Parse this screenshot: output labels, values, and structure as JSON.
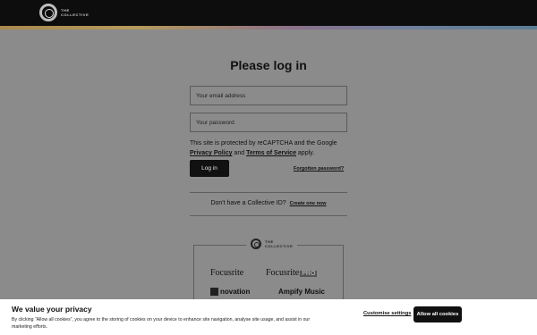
{
  "header": {
    "logo_text_1": "THE",
    "logo_text_2": "COLLECTIVE"
  },
  "login": {
    "title": "Please log in",
    "email_placeholder": "Your email address",
    "password_placeholder": "Your password",
    "note_1": "This site is protected by reCAPTCHA and the Google ",
    "privacy_link": "Privacy Policy",
    "note_and": " and ",
    "terms_link": "Terms of Service",
    "note_end": " apply.",
    "login_button": "Log in",
    "forgot_link": "Forgotten password?",
    "signup_text": "Don't have a Collective ID?",
    "signup_link": "Create one now"
  },
  "brands": {
    "logo_text_1": "THE",
    "logo_text_2": "COLLECTIVE",
    "items": [
      "Focusrite",
      "Focusrite",
      "novation",
      "Ampify Music"
    ],
    "pro_badge": "PRO"
  },
  "cookie": {
    "title": "We value your privacy",
    "text": "By clicking “Allow all cookies”, you agree to the storing of cookies on your device to enhance site navigation, analyse site usage, and assist in our marketing efforts.",
    "customise_label": "Customise settings",
    "allow_label": "Allow all cookies"
  },
  "colors": {
    "header_bg": "#0d0d0d",
    "overlay_bg": "#8b8b8b",
    "button_bg": "#111111",
    "cookie_bg": "#ffffff"
  }
}
